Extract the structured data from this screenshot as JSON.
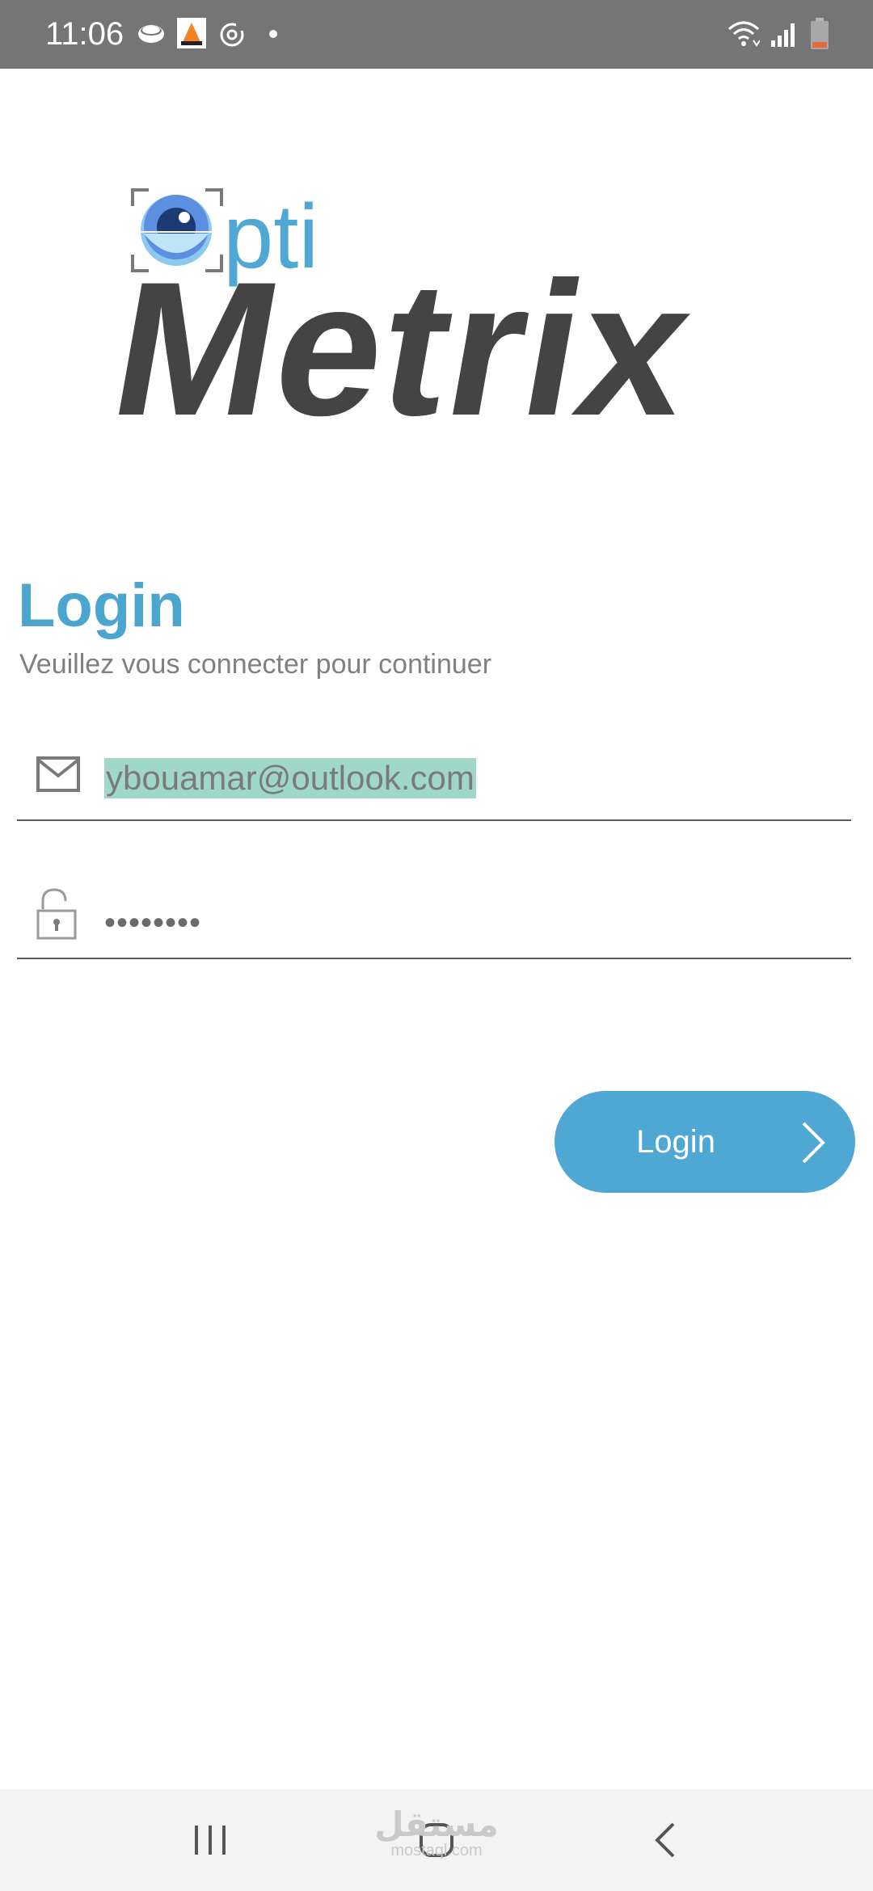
{
  "status_bar": {
    "time": "11:06",
    "left_icons": [
      "cloud-icon",
      "vlc-cone-icon",
      "sync-icon",
      "notification-dot-icon"
    ],
    "right_icons": [
      "wifi-icon",
      "signal-icon",
      "battery-icon"
    ]
  },
  "logo": {
    "prefix": "pti",
    "name": "Metrix",
    "accent_color": "#4fa8d3",
    "dark_color": "#444444"
  },
  "login": {
    "title": "Login",
    "subtitle": "Veuillez vous connecter pour continuer",
    "email_icon": "mail-icon",
    "email_value": "ybouamar@outlook.com",
    "password_icon": "unlock-icon",
    "password_value": "••••••••",
    "button_label": "Login",
    "button_icon": "chevron-right-icon",
    "accent_color": "#4aa6cf"
  },
  "nav_bar": {
    "recents_icon": "recents-icon",
    "home_icon": "home-icon",
    "back_icon": "back-icon",
    "watermark": "مستقل",
    "watermark_sub": "mostaql.com"
  }
}
